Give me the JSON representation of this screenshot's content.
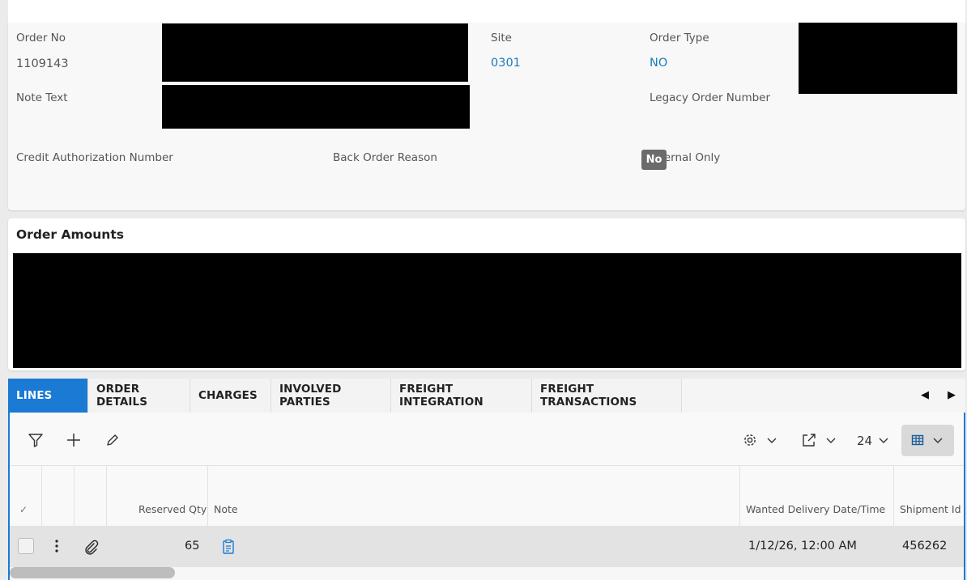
{
  "header": {
    "order_no_label": "Order No",
    "order_no_value": "1109143",
    "site_label": "Site",
    "site_value": "0301",
    "order_type_label": "Order Type",
    "order_type_value": "NO",
    "note_text_label": "Note Text",
    "legacy_order_label": "Legacy Order Number",
    "credit_auth_label": "Credit Authorization Number",
    "back_order_reason_label": "Back Order Reason",
    "internal_only_label": "Internal Only",
    "internal_only_value": "No"
  },
  "order_amounts": {
    "title": "Order Amounts"
  },
  "tabs": [
    {
      "label": "LINES",
      "active": true
    },
    {
      "label": "ORDER DETAILS",
      "active": false
    },
    {
      "label": "CHARGES",
      "active": false
    },
    {
      "label": "INVOLVED PARTIES",
      "active": false
    },
    {
      "label": "FREIGHT INTEGRATION",
      "active": false
    },
    {
      "label": "FREIGHT TRANSACTIONS",
      "active": false
    }
  ],
  "toolbar": {
    "page_size": "24"
  },
  "table": {
    "columns": {
      "reserved_qty": "Reserved Qty",
      "note": "Note",
      "wanted_delivery": "Wanted Delivery Date/Time",
      "shipment_id": "Shipment Id"
    },
    "rows": [
      {
        "reserved_qty": "65",
        "wanted_delivery": "1/12/26, 12:00 AM",
        "shipment_id": "456262"
      }
    ]
  },
  "colors": {
    "accent": "#1a7ad4",
    "link": "#1a7ab8",
    "badge": "#6b6b6b"
  }
}
